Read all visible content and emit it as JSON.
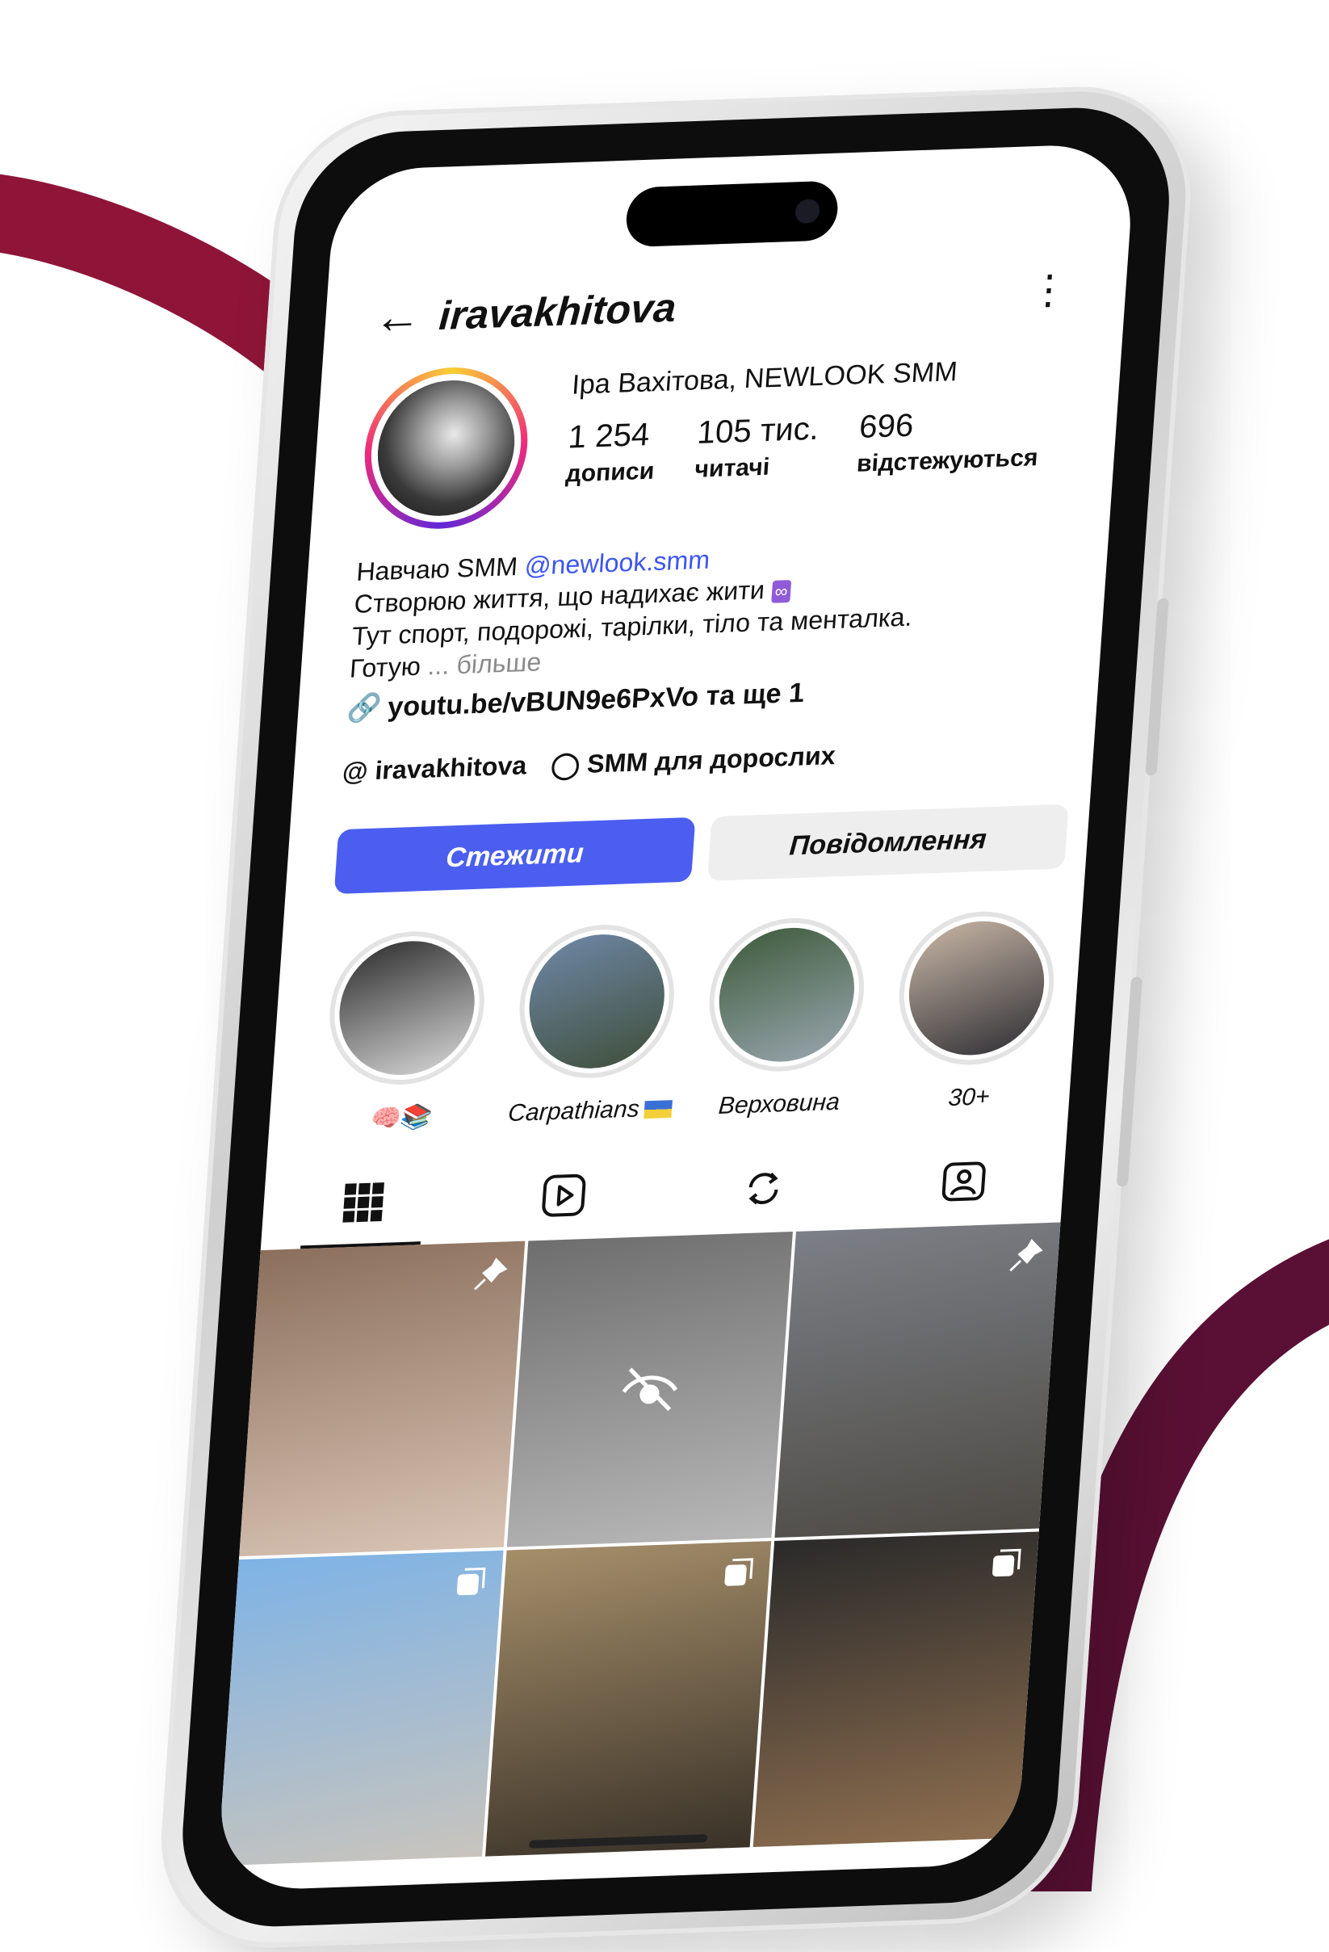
{
  "header": {
    "back_icon": "arrow-left-icon",
    "username": "iravakhitova",
    "more_icon": "vertical-dots-icon"
  },
  "profile": {
    "full_name": "Іра Вахітова, NEWLOOK SMM",
    "stats": [
      {
        "value": "1 254",
        "label": "дописи"
      },
      {
        "value": "105 тис.",
        "label": "читачі"
      },
      {
        "value": "696",
        "label": "відстежуються"
      }
    ]
  },
  "bio": {
    "line1_prefix": "Навчаю SMM ",
    "mention": "@newlook.smm",
    "line2": "Створюю життя, що надихає жити",
    "line3": "Тут спорт, подорожі, тарілки, тіло та менталка.",
    "line4_prefix": "Готую ",
    "more": "... більше",
    "link": "youtu.be/vBUN9e6PxVo та ще 1"
  },
  "threads": {
    "handle": "iravakhitova",
    "channel": "SMM для дорослих"
  },
  "buttons": {
    "follow": "Стежити",
    "message": "Повідомлення"
  },
  "highlights": [
    {
      "label": "🧠📚",
      "colors": [
        "#2b2b2b",
        "#d9d9d9"
      ]
    },
    {
      "label": "Carpathians",
      "colors": [
        "#6f88a8",
        "#3f4f3a"
      ]
    },
    {
      "label": "Верховина",
      "colors": [
        "#3d5a3a",
        "#9aa7b0"
      ]
    },
    {
      "label": "30+",
      "colors": [
        "#c9b7a6",
        "#2f2f35"
      ]
    }
  ],
  "tabs": [
    {
      "icon": "grid-icon",
      "active": true
    },
    {
      "icon": "reels-play-icon",
      "active": false
    },
    {
      "icon": "reposts-icon",
      "active": false
    },
    {
      "icon": "tagged-user-icon",
      "active": false
    }
  ],
  "posts": [
    {
      "badge": "pin-icon",
      "colors": [
        "#8b6f5c",
        "#d9c4b5"
      ]
    },
    {
      "badge": "hidden-eye-icon",
      "colors": [
        "#6e6e6e",
        "#b8b8b8"
      ]
    },
    {
      "badge": "pin-icon",
      "colors": [
        "#7c7f86",
        "#4d4a44"
      ]
    },
    {
      "badge": "carousel-icon",
      "colors": [
        "#7eb3e6",
        "#c8c4bd"
      ]
    },
    {
      "badge": "carousel-icon",
      "colors": [
        "#a58e6a",
        "#3a3228"
      ]
    },
    {
      "badge": "carousel-icon",
      "colors": [
        "#2a2a2a",
        "#8f6f50"
      ]
    }
  ],
  "colors": {
    "accent": "#4b5ef0",
    "mention": "#3d56f0",
    "deco_top": "#8e1537",
    "deco_bottom": "#5a1034"
  }
}
